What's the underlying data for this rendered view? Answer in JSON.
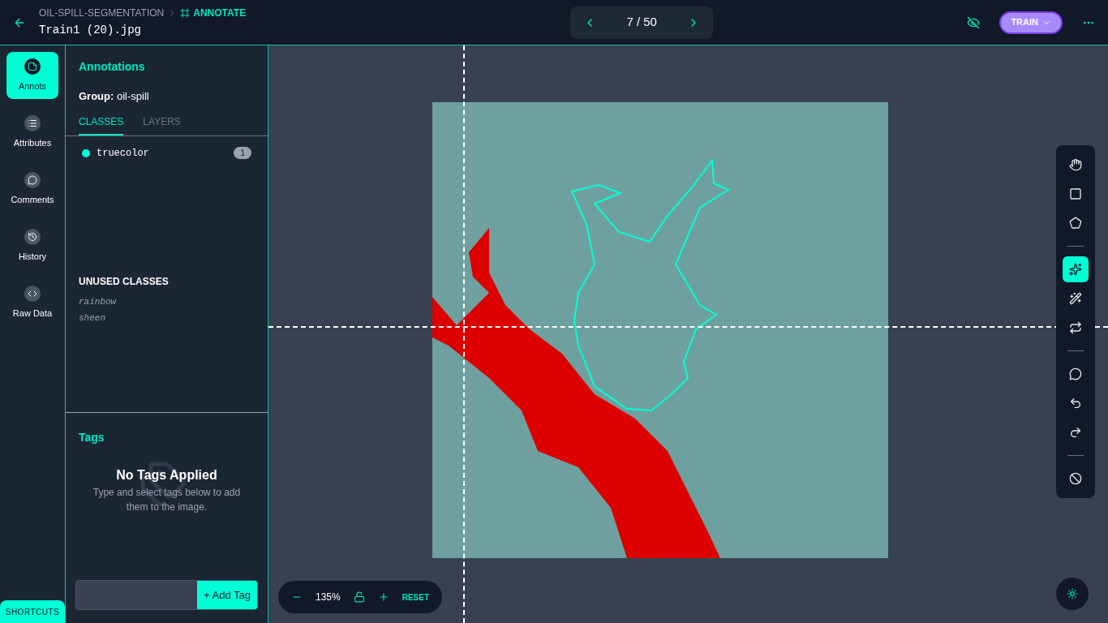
{
  "header": {
    "breadcrumb": "OIL-SPILL-SEGMENTATION",
    "mode": "ANNOTATE",
    "filename": "Train1 (20).jpg",
    "pager": "7 / 50",
    "split": "TRAIN"
  },
  "nav": [
    {
      "label": "Annots",
      "selected": true
    },
    {
      "label": "Attributes",
      "selected": false
    },
    {
      "label": "Comments",
      "selected": false
    },
    {
      "label": "History",
      "selected": false
    },
    {
      "label": "Raw Data",
      "selected": false
    }
  ],
  "shortcuts": "SHORTCUTS",
  "panel": {
    "title": "Annotations",
    "group_label": "Group:",
    "group": "oil-spill",
    "tabs": [
      {
        "label": "CLASSES",
        "selected": true
      },
      {
        "label": "LAYERS",
        "selected": false
      }
    ],
    "classes": [
      {
        "name": "truecolor",
        "count": "1",
        "color": "#00ffd5"
      }
    ],
    "unused_title": "UNUSED CLASSES",
    "unused": [
      "rainbow",
      "sheen"
    ]
  },
  "tags": {
    "title": "Tags",
    "empty_title": "No Tags Applied",
    "empty_text": "Type and select tags below to add them to the image.",
    "button": "+ Add Tag"
  },
  "tools": [
    {
      "kind": "tool",
      "selected": false
    },
    {
      "kind": "tool",
      "selected": false
    },
    {
      "kind": "tool",
      "selected": false
    },
    {
      "kind": "divider"
    },
    {
      "kind": "tool",
      "selected": true
    },
    {
      "kind": "tool",
      "selected": false
    },
    {
      "kind": "tool",
      "selected": false
    },
    {
      "kind": "divider"
    },
    {
      "kind": "tool",
      "selected": false
    },
    {
      "kind": "tool",
      "selected": false
    },
    {
      "kind": "tool",
      "selected": false
    },
    {
      "kind": "divider"
    },
    {
      "kind": "tool",
      "selected": false
    }
  ],
  "zoom": {
    "value": "135%",
    "reset": "RESET"
  }
}
